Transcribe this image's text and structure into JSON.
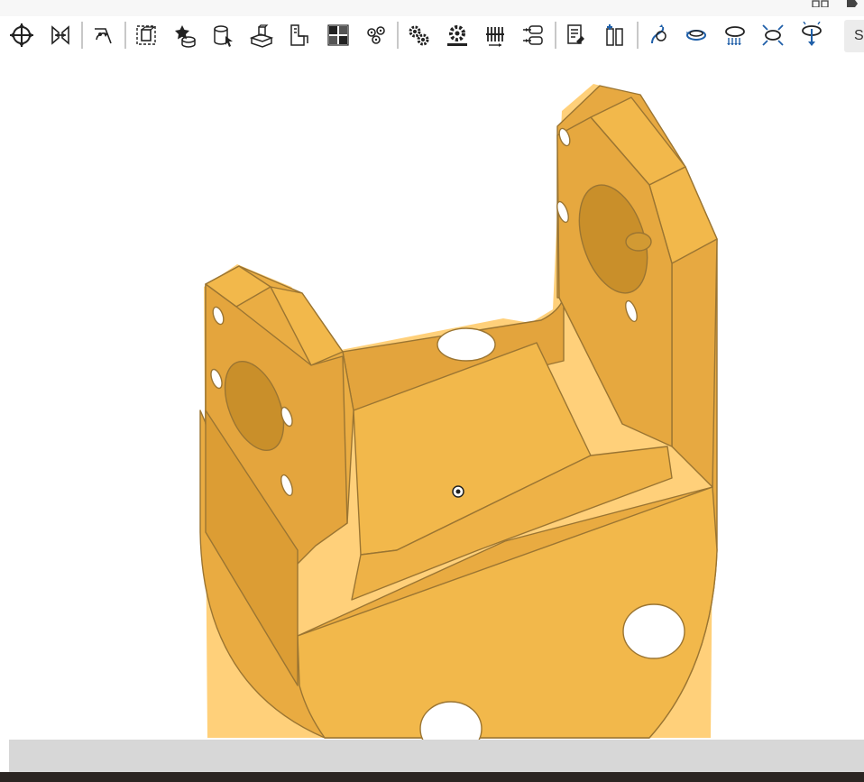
{
  "toolbar": {
    "tools": [
      {
        "name": "transform-icon"
      },
      {
        "name": "mirror-icon"
      },
      {
        "name": "sketch-rotate-icon"
      },
      {
        "name": "bounding-box-icon"
      },
      {
        "name": "insert-part-icon"
      },
      {
        "name": "assembly-icon"
      },
      {
        "name": "extrude-part-icon"
      },
      {
        "name": "replace-part-icon"
      },
      {
        "name": "layout-icon"
      },
      {
        "name": "exploded-view-icon"
      },
      {
        "name": "gear-icon"
      },
      {
        "name": "gear-rack-icon"
      },
      {
        "name": "linear-pattern-icon"
      },
      {
        "name": "constraint-icon"
      },
      {
        "name": "bill-of-materials-icon"
      },
      {
        "name": "parts-list-icon"
      },
      {
        "name": "motion-path-icon"
      },
      {
        "name": "rotate-around-icon"
      },
      {
        "name": "drop-icon"
      },
      {
        "name": "expand-icon"
      },
      {
        "name": "download-icon"
      }
    ],
    "overflow_label": "S"
  },
  "viewport": {
    "model_color": "#f2b84b",
    "model_shadow_color": "#d99d32",
    "model_edge_color": "#9b7532",
    "highlight_color": "#ffcb6b"
  },
  "colors": {
    "icon_dark": "#222222",
    "icon_blue": "#1f5fa8"
  }
}
